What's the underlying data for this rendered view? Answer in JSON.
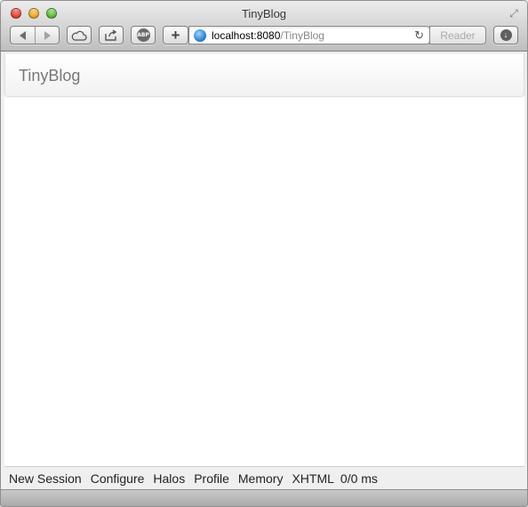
{
  "window": {
    "title": "TinyBlog"
  },
  "toolbar": {
    "url_host": "localhost:8080",
    "url_path": "/TinyBlog",
    "reader_label": "Reader",
    "abp_label": "ABP",
    "add_tab_label": "+"
  },
  "page": {
    "brand": "TinyBlog"
  },
  "seaside_toolbar": {
    "links": [
      "New Session",
      "Configure",
      "Halos",
      "Profile",
      "Memory",
      "XHTML"
    ],
    "timing": "0/0 ms"
  }
}
